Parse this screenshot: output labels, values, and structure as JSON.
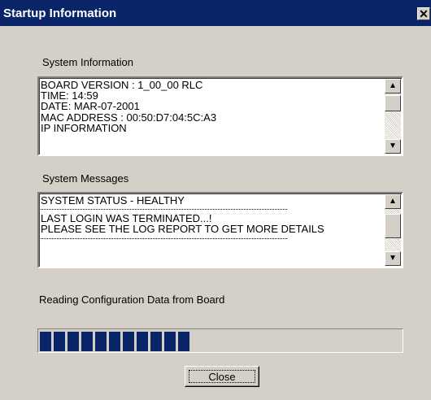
{
  "window": {
    "title": "Startup Information",
    "close_glyph": "✕"
  },
  "system_info": {
    "label": "System Information",
    "lines": [
      "BOARD VERSION : 1_00_00 RLC",
      "TIME: 14:59",
      "DATE: MAR-07-2001",
      "MAC ADDRESS : 00:50:D7:04:5C:A3",
      "IP INFORMATION"
    ]
  },
  "system_messages": {
    "label": "System Messages",
    "line1": "SYSTEM STATUS - HEALTHY",
    "line2": "LAST LOGIN WAS TERMINATED...!",
    "line3": "PLEASE SEE THE LOG REPORT TO GET MORE DETAILS"
  },
  "progress": {
    "label": "Reading Configuration Data from Board",
    "blocks_filled": 11,
    "fraction": 0.44
  },
  "buttons": {
    "close_label": "Close"
  },
  "scroll": {
    "up_glyph": "▲",
    "down_glyph": "▼"
  },
  "colors": {
    "title_bar": "#0a246a",
    "dialog_bg": "#d4d0c8",
    "progress_fill": "#0a246a"
  }
}
